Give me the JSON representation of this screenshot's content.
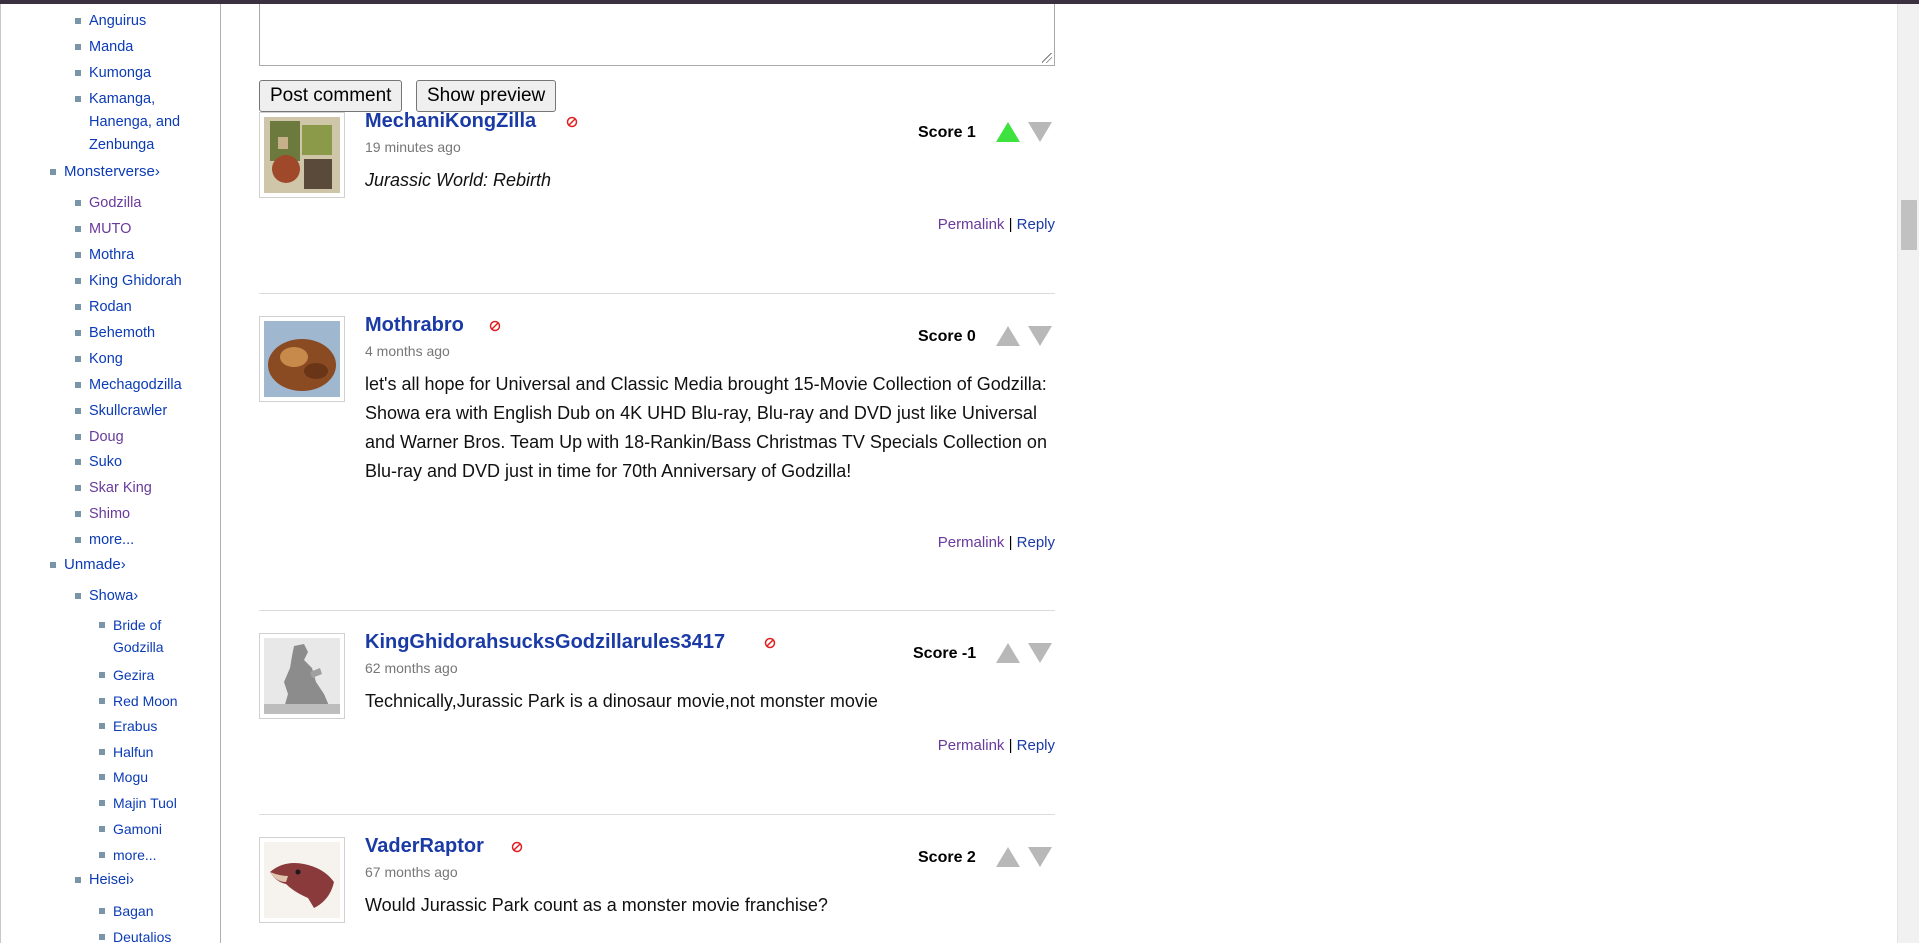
{
  "sidebar": {
    "items": [
      {
        "label": "Anguirus",
        "level": 2,
        "visited": false
      },
      {
        "label": "Manda",
        "level": 2,
        "visited": false
      },
      {
        "label": "Kumonga",
        "level": 2,
        "visited": false
      },
      {
        "label": "Kamanga,",
        "level": 2,
        "visited": false
      },
      {
        "label": "Hanenga, and",
        "level": 2,
        "visited": false
      },
      {
        "label": "Zenbunga",
        "level": 2,
        "visited": false
      },
      {
        "label": "Monsterverse›",
        "level": 1,
        "visited": false
      },
      {
        "label": "Godzilla",
        "level": 2,
        "visited": true
      },
      {
        "label": "MUTO",
        "level": 2,
        "visited": true
      },
      {
        "label": "Mothra",
        "level": 2,
        "visited": false
      },
      {
        "label": "King Ghidorah",
        "level": 2,
        "visited": false
      },
      {
        "label": "Rodan",
        "level": 2,
        "visited": false
      },
      {
        "label": "Behemoth",
        "level": 2,
        "visited": false
      },
      {
        "label": "Kong",
        "level": 2,
        "visited": false
      },
      {
        "label": "Mechagodzilla",
        "level": 2,
        "visited": false
      },
      {
        "label": "Skullcrawler",
        "level": 2,
        "visited": false
      },
      {
        "label": "Doug",
        "level": 2,
        "visited": true
      },
      {
        "label": "Suko",
        "level": 2,
        "visited": false
      },
      {
        "label": "Skar King",
        "level": 2,
        "visited": true
      },
      {
        "label": "Shimo",
        "level": 2,
        "visited": true
      },
      {
        "label": "more...",
        "level": 2,
        "visited": false
      },
      {
        "label": "Unmade›",
        "level": 1,
        "visited": false
      },
      {
        "label": "Showa›",
        "level": 2,
        "visited": false
      },
      {
        "label": "Bride of",
        "level": 3,
        "visited": false
      },
      {
        "label": "Godzilla",
        "level": 3,
        "visited": false
      },
      {
        "label": "Gezira",
        "level": 3,
        "visited": false
      },
      {
        "label": "Red Moon",
        "level": 3,
        "visited": false
      },
      {
        "label": "Erabus",
        "level": 3,
        "visited": false
      },
      {
        "label": "Halfun",
        "level": 3,
        "visited": false
      },
      {
        "label": "Mogu",
        "level": 3,
        "visited": false
      },
      {
        "label": "Majin Tuol",
        "level": 3,
        "visited": false
      },
      {
        "label": "Gamoni",
        "level": 3,
        "visited": false
      },
      {
        "label": "more...",
        "level": 3,
        "visited": false
      },
      {
        "label": "Heisei›",
        "level": 2,
        "visited": false
      },
      {
        "label": "Bagan",
        "level": 3,
        "visited": false
      },
      {
        "label": "Deutalios",
        "level": 3,
        "visited": false
      }
    ]
  },
  "editor": {
    "post_label": "Post comment",
    "preview_label": "Show preview"
  },
  "comments": [
    {
      "username": "MechaniKongZilla",
      "time": "19 minutes ago",
      "score": "Score 1",
      "body": "Jurassic World: Rebirth",
      "italic": true,
      "upvoted": true,
      "permalink": "Permalink",
      "reply": "Reply"
    },
    {
      "username": "Mothrabro",
      "time": "4 months ago",
      "score": "Score 0",
      "body": "let's all hope for Universal and Classic Media brought 15-Movie Collection of Godzilla: Showa era with English Dub on 4K UHD Blu-ray, Blu-ray and DVD just like Universal and Warner Bros. Team Up with 18-Rankin/Bass Christmas TV Specials Collection on Blu-ray and DVD just in time for 70th Anniversary of Godzilla!",
      "italic": false,
      "upvoted": false,
      "permalink": "Permalink",
      "reply": "Reply"
    },
    {
      "username": "KingGhidorahsucksGodzillarules3417",
      "time": "62 months ago",
      "score": "Score -1",
      "body": "Technically,Jurassic Park is a dinosaur movie,not monster movie",
      "italic": false,
      "upvoted": false,
      "permalink": "Permalink",
      "reply": "Reply"
    },
    {
      "username": "VaderRaptor",
      "time": "67 months ago",
      "score": "Score 2",
      "body": "Would Jurassic Park count as a monster movie franchise?",
      "italic": false,
      "upvoted": false,
      "permalink": "Permalink",
      "reply": "Reply"
    }
  ],
  "colors": {
    "upvote_active": "#3ee23e",
    "vote_inactive": "#b8b8b8",
    "username": "#1a3aa6",
    "visited_link": "#6a3a9c",
    "block_icon": "#e02020"
  }
}
